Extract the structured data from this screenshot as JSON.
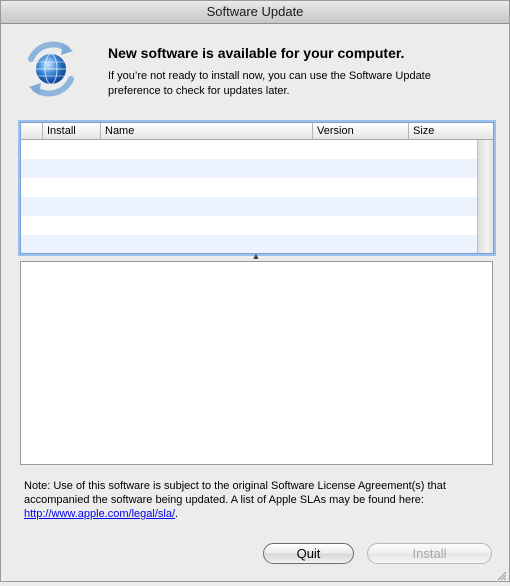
{
  "window": {
    "title": "Software Update"
  },
  "header": {
    "icon": "software-update-globe-icon",
    "headline": "New software is available for your computer.",
    "subtext": "If you’re not ready to install now, you can use the Software Update preference to check for updates later."
  },
  "table": {
    "columns": [
      "",
      "Install",
      "Name",
      "Version",
      "Size"
    ],
    "rows": []
  },
  "note": {
    "text": "Note: Use of this software is subject to the original Software License Agreement(s) that accompanied the software being updated. A list of Apple SLAs may be found here: ",
    "link_text": "http://www.apple.com/legal/sla/",
    "trailing": "."
  },
  "buttons": {
    "quit_label": "Quit",
    "install_label": "Install"
  }
}
